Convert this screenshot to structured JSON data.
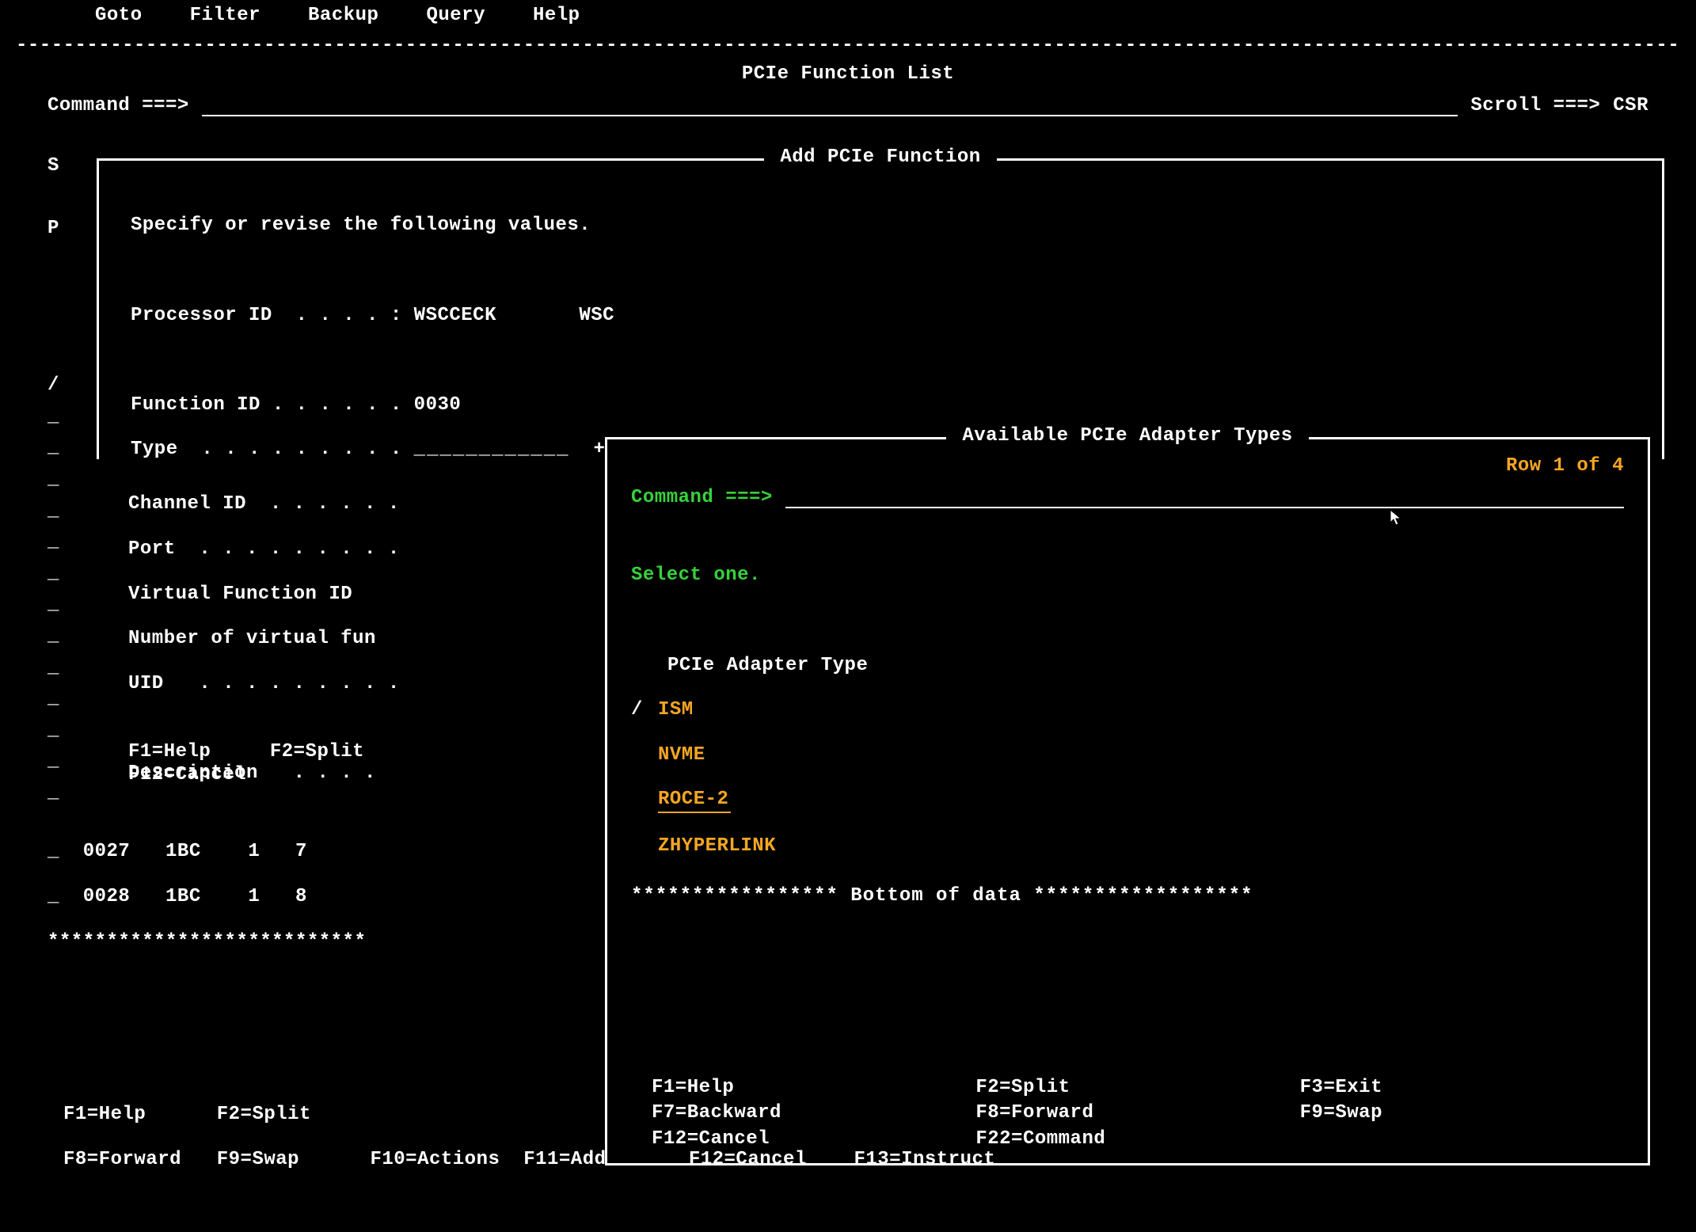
{
  "menu": {
    "items": [
      "Goto",
      "Filter",
      "Backup",
      "Query",
      "Help"
    ]
  },
  "page": {
    "title": "PCIe Function List",
    "command_prompt": "Command ===>",
    "scroll_label": "Scroll ===>",
    "scroll_value": "CSR",
    "left_markers": "S\n\nP\n\n\n\n\n/\n_\n_\n_\n_\n_\n_\n_\n_\n_\n_\n_\n_\n_"
  },
  "add_panel": {
    "title": "Add PCIe Function",
    "instruction": "Specify or revise the following values.",
    "processor_id_label": "Processor ID  . . . . :",
    "processor_id_value": "WSCCECK",
    "processor_id_extra": "WSC",
    "function_id_label": "Function ID . . . . . .",
    "function_id_value": "0030",
    "type_label": "Type  . . . . . . . . .",
    "type_field_blank": "____________",
    "channel_id_label": "Channel ID  . . . . . .",
    "port_label": "Port  . . . . . . . . .",
    "vfid_label": "Virtual Function ID",
    "num_vf_label": "Number of virtual fun",
    "uid_label": "UID   . . . . . . . . .",
    "description_label": "Description   . . . .",
    "fkeys": {
      "f1": "F1=Help",
      "f2": "F2=Split",
      "f12": "F12=Cancel"
    }
  },
  "types_popup": {
    "title": "Available PCIe Adapter Types",
    "row_counter": "Row 1 of 4",
    "command_prompt": "Command ===>",
    "select_instruction": "Select one.",
    "header": "PCIe Adapter Type",
    "items": [
      {
        "selector": "/",
        "label": "ISM"
      },
      {
        "selector": "",
        "label": "NVME"
      },
      {
        "selector": "",
        "label": "ROCE-2"
      },
      {
        "selector": "",
        "label": "ZHYPERLINK"
      }
    ],
    "bottom_of_data": "***************** Bottom of data ******************",
    "fkeys": {
      "f1": "F1=Help",
      "f2": "F2=Split",
      "f3": "F3=Exit",
      "f7": "F7=Backward",
      "f8": "F8=Forward",
      "f9": "F9=Swap",
      "f12": "F12=Cancel",
      "f22": "F22=Command"
    }
  },
  "background_rows": {
    "r1": "_  0027   1BC    1   7",
    "r2": "_  0028   1BC    1   8",
    "r3": "***************************"
  },
  "outer_fkeys": {
    "line1": "F1=Help      F2=Split",
    "line2": "F8=Forward   F9=Swap      F10=Actions  F11=Add       F12=Cancel    F13=Instruct"
  }
}
